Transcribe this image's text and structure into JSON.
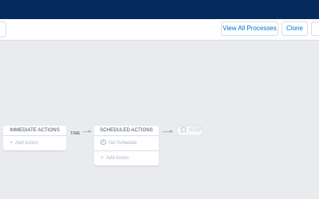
{
  "toolbar": {
    "view_all_processes_label": "View All Processes",
    "clone_label": "Clone",
    "more_label": ""
  },
  "flow": {
    "immediate": {
      "title": "IMMEDIATE ACTIONS",
      "add_action_label": "Add Action"
    },
    "time_label": "TIME",
    "scheduled": {
      "title": "SCHEDULED ACTIONS",
      "set_schedule_label": "Set Schedule",
      "add_action_label": "Add Action"
    },
    "stop_label": "STOP"
  },
  "colors": {
    "header_bg": "#072a5e",
    "canvas_bg": "#e9ebee",
    "link": "#0070d2",
    "muted_text": "#a8b3c2"
  },
  "icons": {
    "plus": "plus-icon",
    "clock": "clock-icon",
    "stop": "stop-icon"
  }
}
